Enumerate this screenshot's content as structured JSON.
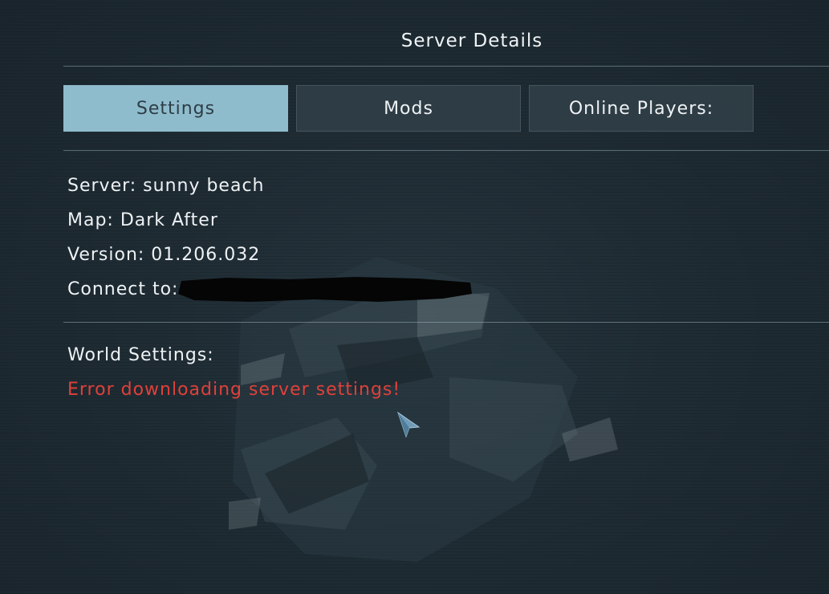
{
  "header": {
    "title": "Server Details"
  },
  "tabs": [
    {
      "label": "Settings",
      "active": true
    },
    {
      "label": "Mods",
      "active": false
    },
    {
      "label": "Online Players:",
      "active": false
    }
  ],
  "server_info": {
    "server": "Server: sunny beach",
    "map": "Map: Dark After",
    "version": "Version: 01.206.032",
    "connect_to_label": "Connect to:"
  },
  "world_settings": {
    "heading": "World Settings:",
    "error": "Error downloading server settings!"
  },
  "colors": {
    "active_tab": "#8fbccd",
    "error_text": "#e0403a",
    "background": "#1e2b33"
  },
  "icons": {
    "cursor": "mouse-cursor-icon"
  }
}
